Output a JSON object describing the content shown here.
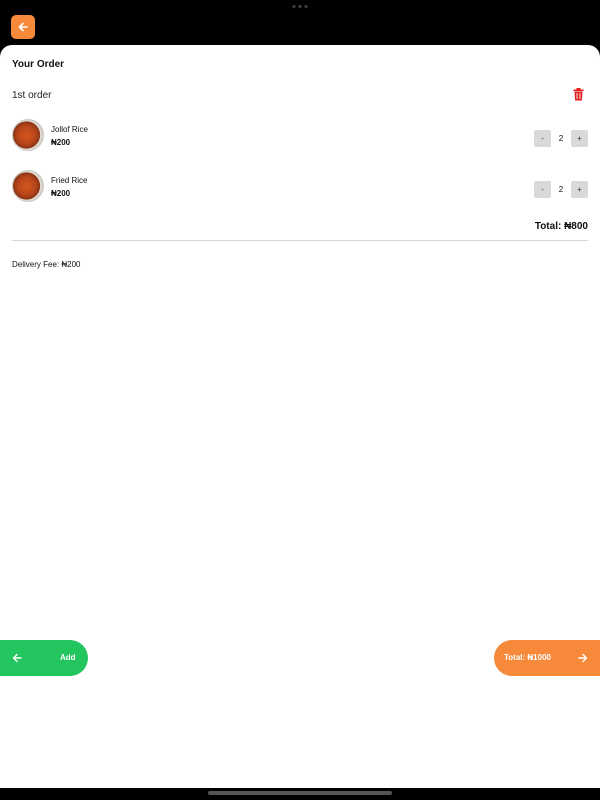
{
  "header": {
    "back_icon": "arrow-left-icon",
    "accent": "#f7893b"
  },
  "order": {
    "title": "Your Order",
    "label": "1st order",
    "delete_icon": "trash-icon",
    "items": [
      {
        "name": "Jollof Rice",
        "price": "₦200",
        "decrement": "-",
        "quantity": "2",
        "increment": "+"
      },
      {
        "name": "Fried Rice",
        "price": "₦200",
        "decrement": "-",
        "quantity": "2",
        "increment": "+"
      }
    ],
    "total": "Total: ₦800",
    "delivery_fee": "Delivery Fee: ₦200"
  },
  "footer": {
    "add_label": "Add",
    "add_icon": "arrow-left-icon",
    "add_color": "#22c55e",
    "checkout_label": "Total: ₦1000",
    "checkout_icon": "arrow-right-icon",
    "checkout_color": "#f7893b"
  }
}
